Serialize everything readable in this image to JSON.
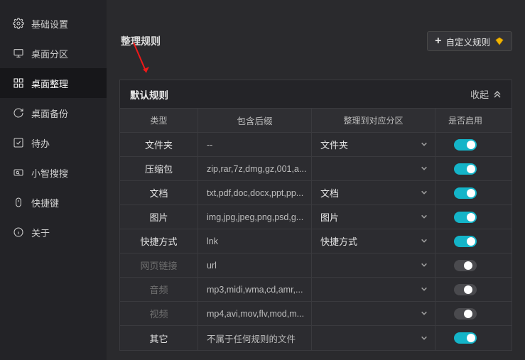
{
  "sidebar": {
    "items": [
      {
        "label": "基础设置",
        "name": "sidebar-item-basic-settings"
      },
      {
        "label": "桌面分区",
        "name": "sidebar-item-desktop-zones"
      },
      {
        "label": "桌面整理",
        "name": "sidebar-item-desktop-organize"
      },
      {
        "label": "桌面备份",
        "name": "sidebar-item-desktop-backup"
      },
      {
        "label": "待办",
        "name": "sidebar-item-todo"
      },
      {
        "label": "小智搜搜",
        "name": "sidebar-item-xiaozhi-search"
      },
      {
        "label": "快捷键",
        "name": "sidebar-item-shortcuts"
      },
      {
        "label": "关于",
        "name": "sidebar-item-about"
      }
    ],
    "activeIndex": 2
  },
  "header": {
    "section_title": "整理规则",
    "custom_button_label": "自定义规则"
  },
  "panel": {
    "title": "默认规则",
    "collapse_label": "收起"
  },
  "table": {
    "columns": [
      "类型",
      "包含后缀",
      "整理到对应分区",
      "是否启用"
    ],
    "rows": [
      {
        "type": "文件夹",
        "ext": "--",
        "target": "文件夹",
        "enabled": true,
        "disabled": false
      },
      {
        "type": "压缩包",
        "ext": "zip,rar,7z,dmg,gz,001,a...",
        "target": "",
        "enabled": true,
        "disabled": false
      },
      {
        "type": "文档",
        "ext": "txt,pdf,doc,docx,ppt,pp...",
        "target": "文档",
        "enabled": true,
        "disabled": false
      },
      {
        "type": "图片",
        "ext": "img,jpg,jpeg,png,psd,g...",
        "target": "图片",
        "enabled": true,
        "disabled": false
      },
      {
        "type": "快捷方式",
        "ext": "lnk",
        "target": "快捷方式",
        "enabled": true,
        "disabled": false
      },
      {
        "type": "网页链接",
        "ext": "url",
        "target": "",
        "enabled": false,
        "disabled": true
      },
      {
        "type": "音频",
        "ext": "mp3,midi,wma,cd,amr,...",
        "target": "",
        "enabled": false,
        "disabled": true
      },
      {
        "type": "视频",
        "ext": "mp4,avi,mov,flv,mod,m...",
        "target": "",
        "enabled": false,
        "disabled": true
      },
      {
        "type": "其它",
        "ext": "不属于任何规则的文件",
        "target": "",
        "enabled": true,
        "disabled": false
      }
    ]
  }
}
